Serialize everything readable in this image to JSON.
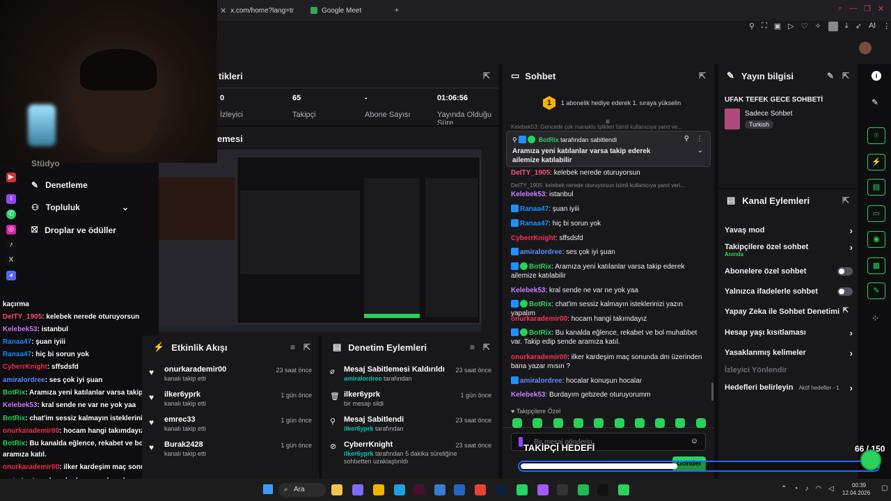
{
  "browser": {
    "tabs": [
      {
        "label": "x.com/home?lang=tr"
      },
      {
        "label": "Google Meet"
      }
    ],
    "new_tab": "+",
    "ai_label": "AI"
  },
  "stats_panel": {
    "title": "tikleri",
    "stats": [
      {
        "value": "0",
        "label": "İzleyici"
      },
      {
        "value": "65",
        "label": "Takipçi"
      },
      {
        "value": "-",
        "label": "Abone Sayısı"
      },
      {
        "value": "01:06:56",
        "label": "Yayında Olduğu Süre"
      }
    ]
  },
  "preview_panel": {
    "title": "emesi"
  },
  "left_nav": {
    "items": [
      {
        "label": "Stüdyo"
      },
      {
        "label": "Denetleme"
      },
      {
        "label": "Topluluk"
      },
      {
        "label": "Droplar ve ödüller"
      }
    ]
  },
  "overlay_chat": {
    "header": "kaçırma",
    "messages": [
      {
        "user": "DeITY_1905",
        "text": ": kelebek nerede oturuyorsun",
        "color": "#ff4f7b"
      },
      {
        "user": "Kelebek53",
        "text": ": istanbul",
        "color": "#c77dff"
      },
      {
        "user": "Ranaa47",
        "text": ": şuan iyiii",
        "color": "#1e90ff"
      },
      {
        "user": "Ranaa47",
        "text": ": hiç bi sorun yok",
        "color": "#1e90ff"
      },
      {
        "user": "CyberrKnight",
        "text": ": sffsdsfd",
        "color": "#ff2d55"
      },
      {
        "user": "amiralordree",
        "text": ": ses çok iyi şuan",
        "color": "#5b8cff"
      },
      {
        "user": "BotRix",
        "text": ": Aramıza yeni katılanlar varsa takip ederek ailemize katılabilir",
        "color": "#2bd15a"
      },
      {
        "user": "Kelebek53",
        "text": ": kral sende ne var ne yok yaa",
        "color": "#c77dff"
      },
      {
        "user": "BotRix",
        "text": ": chat'im sessiz kalmayın isteklerinizi yazın yapalım",
        "color": "#2bd15a"
      },
      {
        "user": "onurkarademir00",
        "text": ": hocam hangi takımdayız",
        "color": "#ff2d55"
      },
      {
        "user": "BotRix",
        "text": ": Bu kanalda eğlence, rekabet ve bol muhabbet var. Takip edip sende",
        "color": "#2bd15a"
      },
      {
        "user": "",
        "text": "aramıza katıl.",
        "color": "#efeff1"
      },
      {
        "user": "onurkarademir00",
        "text": ": ilker kardeşim maç sonunda dm üzerinden bana yazar mısın ?",
        "color": "#ff2d55"
      },
      {
        "user": "amiralordree",
        "text": ": hocalar konuşun hocalar",
        "color": "#5b8cff"
      },
      {
        "user": "Kelebek53",
        "text": ": Burdayım gebzede oturuyorumm",
        "color": "#c77dff"
      }
    ]
  },
  "activity_feed": {
    "title": "Etkinlik Akışı",
    "items": [
      {
        "name": "onurkarademir00",
        "sub": "kanalı takip etti",
        "time": "23 saat önce"
      },
      {
        "name": "ilker6yprk",
        "sub": "kanalı takip etti",
        "time": "1 gün önce"
      },
      {
        "name": "emrec33",
        "sub": "kanalı takip etti",
        "time": "1 gün önce"
      },
      {
        "name": "Burak2428",
        "sub": "kanalı takip etti",
        "time": "1 gün önce"
      }
    ]
  },
  "mod_log": {
    "title": "Denetim Eylemleri",
    "items": [
      {
        "name": "Mesaj Sabitlemesi Kaldırıldı",
        "actor": "amiralordree",
        "sub": " tarafından",
        "time": "23 saat önce"
      },
      {
        "name": "ilker6yprk",
        "actor": "",
        "sub": "bir mesajı sildi",
        "time": "1 gün önce"
      },
      {
        "name": "Mesaj Sabitlendi",
        "actor": "ilker6yprk",
        "sub": " tarafından",
        "time": "23 saat önce"
      },
      {
        "name": "CyberrKnight",
        "actor": "ilker6yprk",
        "sub": " tarafından 5 dakika süreliğine sohbetten uzaklaştırıldı",
        "time": "23 saat önce"
      }
    ]
  },
  "chat": {
    "title": "Sohbet",
    "gift_banner": "1 abonelik hediye ederek 1. sıraya yükselin",
    "gift_rank": "1",
    "truncated_top": "Kelebek53: Gencede çok manuklu İşlikleri İsimli kullanıcıya yanıt ve...",
    "pinned": {
      "by_user": "BotRix",
      "by_text": " tarafından sabitlendi",
      "message": "Aramıza yeni katılanlar varsa takip ederek ailemize katılabilir"
    },
    "reply_context": "DeITY_1905: kelebek nerede oturuyorsun isimli kullanıcıya yanıt veri...",
    "messages": [
      {
        "user": "DeITY_1905",
        "text": ": kelebek nerede oturuyorsun",
        "color": "#ff4f7b"
      },
      {
        "user": "Kelebek53",
        "text": ": istanbul",
        "color": "#c77dff"
      },
      {
        "user": "Ranaa47",
        "text": ": şuan iyiii",
        "color": "#1e90ff"
      },
      {
        "user": "Ranaa47",
        "text": ": hiç bi sorun yok",
        "color": "#1e90ff"
      },
      {
        "user": "CyberrKnight",
        "text": ": sffsdsfd",
        "color": "#ff2d55"
      },
      {
        "user": "amiralordree",
        "text": ": ses çok iyi şuan",
        "color": "#5b8cff"
      },
      {
        "user": "BotRix",
        "text": ": Aramıza yeni katılanlar varsa takip ederek ailemize katılabilir",
        "color": "#2bd15a"
      },
      {
        "user": "Kelebek53",
        "text": ": kral sende ne var ne yok yaa",
        "color": "#c77dff"
      },
      {
        "user": "BotRix",
        "text": ": chat'im sessiz kalmayın isteklerinizi yazın yapalım",
        "color": "#2bd15a"
      },
      {
        "user": "onurkarademir00",
        "text": ": hocam hangi takımdayız",
        "color": "#ff2d55"
      },
      {
        "user": "BotRix",
        "text": ": Bu kanalda eğlence, rekabet ve bol muhabbet var. Takip edip sende aramıza katıl.",
        "color": "#2bd15a"
      },
      {
        "user": "onurkarademir00",
        "text": ": ilker kardeşim maç sonunda dm üzerinden bana yazar mısın ?",
        "color": "#ff2d55"
      },
      {
        "user": "amiralordree",
        "text": ": hocalar konuşun hocalar",
        "color": "#5b8cff"
      },
      {
        "user": "Kelebek53",
        "text": ": Burdayım gebzede oturuyorumm",
        "color": "#c77dff"
      }
    ],
    "followers_only": "Takipçilere Özel",
    "input_placeholder": "Bir mesaj gönderin",
    "send_label": "Gönder"
  },
  "stream_info": {
    "title": "Yayın bilgisi",
    "stream_title": "UFAK TEFEK GECE SOHBETİ",
    "category": "Sadece Sohbet",
    "tag": "Turkish"
  },
  "channel_actions": {
    "title": "Kanal Eylemleri",
    "items": [
      {
        "label": "Yavaş mod",
        "control": "arrow"
      },
      {
        "label": "Takipçilere özel sohbet",
        "sub": "Anında",
        "control": "arrow"
      },
      {
        "label": "Abonelere özel sohbet",
        "control": "toggle"
      },
      {
        "label": "Yalnızca ifadelerle sohbet",
        "control": "toggle"
      },
      {
        "label": "Yapay Zeka ile Sohbet Denetimi",
        "control": "external"
      },
      {
        "label": "Hesap yaşı kısıtlaması",
        "control": "arrow"
      },
      {
        "label": "Yasaklanmış kelimeler",
        "control": "arrow"
      },
      {
        "label": "İzleyici Yönlendir",
        "control": "none"
      },
      {
        "label": "Hedefleri belirleyin",
        "sub": "Aktif hedefler - 1",
        "control": "arrow"
      }
    ]
  },
  "follower_goal": {
    "label": "TAKİPÇİ HEDEFİ",
    "count": "66 / 150",
    "progress": 0.44
  },
  "taskbar": {
    "search_label": "Ara",
    "time": "00:39",
    "date": "12.04.2026"
  },
  "colors": {
    "accent_green": "#2bd15a",
    "panel_bg": "#18181b",
    "page_bg": "#0e0e10"
  }
}
